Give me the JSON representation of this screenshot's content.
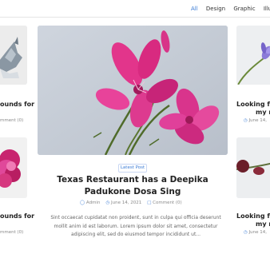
{
  "filters": [
    "All",
    "Design",
    "Graphic",
    "Illustr"
  ],
  "left_col": [
    {
      "title": "ounds for",
      "meta": "mment (0)"
    },
    {
      "title": "ounds for",
      "meta": "mment (0)"
    }
  ],
  "featured": {
    "badge": "Latest Post",
    "title": "Texas Restaurant has a Deepika Padukone Dosa Sing",
    "author": "Admin",
    "date": "June 14, 2021",
    "comments": "Comment (0)",
    "excerpt": "Sint occaecat cupidatat non proident, sunt in culpa qui officia deserunt mollit anim id est laborum. Lorem ipsum dolor sit amet, consectetur adipiscing elit, sed do eiusmod tempor incididunt ut..."
  },
  "right_col": [
    {
      "title1": "Looking fo",
      "title2": "my n",
      "date": "June 14,"
    },
    {
      "title1": "Looking fo",
      "title2": "my n",
      "date": "June 14,"
    }
  ],
  "colors": {
    "accent": "#3a7bd5",
    "flower": "#e0489a"
  }
}
